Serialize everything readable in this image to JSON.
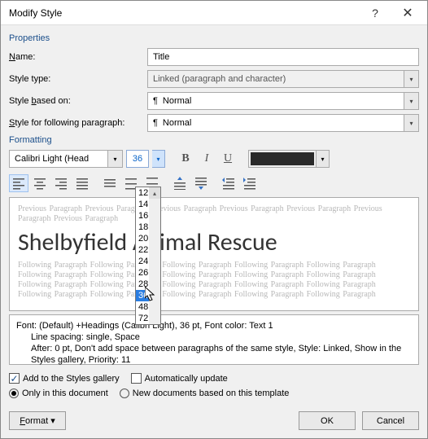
{
  "window": {
    "title": "Modify Style"
  },
  "sections": {
    "properties": "Properties",
    "formatting": "Formatting"
  },
  "fields": {
    "name": {
      "label_pre": "",
      "label_u": "N",
      "label_post": "ame:",
      "value": "Title"
    },
    "style_type": {
      "label": "Style type:",
      "value": "Linked (paragraph and character)"
    },
    "based_on": {
      "label_pre": "Style ",
      "label_u": "b",
      "label_post": "ased on:",
      "value": "Normal"
    },
    "following": {
      "label_pre": "Style for following paragraph:",
      "value": "Normal"
    }
  },
  "format": {
    "font": "Calibri Light (Head",
    "size": "36",
    "sizes": [
      "12",
      "14",
      "16",
      "18",
      "20",
      "22",
      "24",
      "26",
      "28",
      "36",
      "48",
      "72"
    ],
    "selected_size_index": 9
  },
  "preview": {
    "ghost_prev": "Previous Paragraph Previous Paragraph Previous Paragraph Previous Paragraph Previous Paragraph Previous Paragraph Previous Paragraph",
    "sample": "Shelbyfield Animal Rescue",
    "ghost_next": "Following Paragraph Following Paragraph Following Paragraph Following Paragraph Following Paragraph Following Paragraph Following Paragraph Following Paragraph Following Paragraph Following Paragraph Following Paragraph Following Paragraph Following Paragraph Following Paragraph Following Paragraph Following Paragraph Following Paragraph Following Paragraph Following Paragraph Following Paragraph"
  },
  "description": {
    "l1": "Font: (Default) +Headings (Calibri Light), 36 pt, Font color: Text 1",
    "l2": "Line spacing:  single, Space",
    "l3": "After:  0 pt, Don't add space between paragraphs of the same style, Style: Linked, Show in the Styles gallery, Priority: 11"
  },
  "options": {
    "add_gallery": "Add to the Styles gallery",
    "auto_update": "Automatically update",
    "only_doc": "Only in this document",
    "new_docs": "New documents based on this template"
  },
  "buttons": {
    "format": "Format",
    "ok": "OK",
    "cancel": "Cancel"
  },
  "paragraph_symbol": "¶"
}
